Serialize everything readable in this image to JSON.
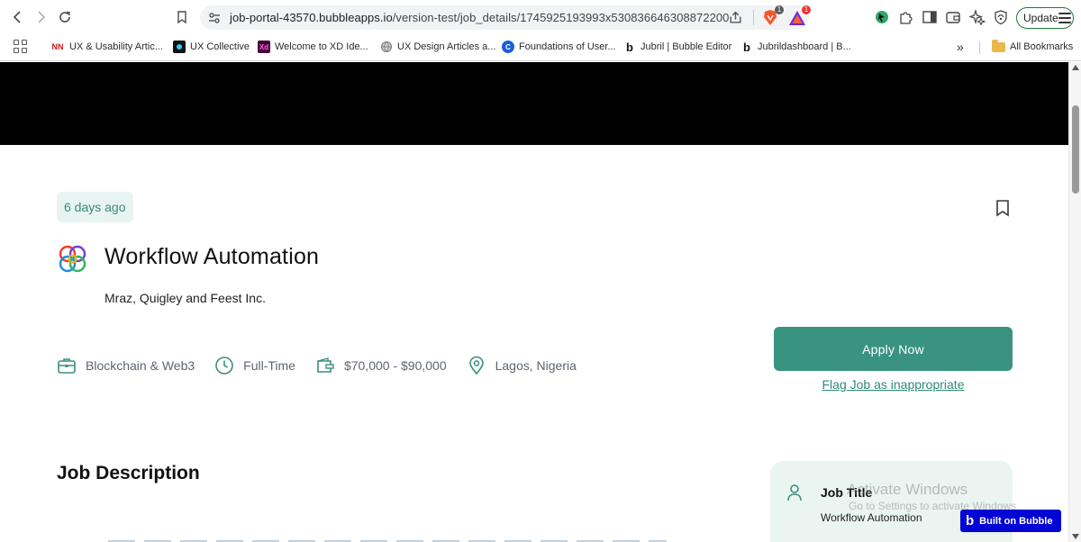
{
  "browser": {
    "url_host": "job-portal-43570.bubbleapps.io",
    "url_path": "/version-test/job_details/1745925193993x530836646308872200",
    "brave_badge": "1",
    "rewards_badge": "1",
    "update_label": "Update",
    "bookmarks": [
      {
        "label": "UX & Usability Artic...",
        "favicon": "NN"
      },
      {
        "label": "UX Collective",
        "favicon": "ux-collective-icon"
      },
      {
        "label": "Welcome to XD Ide...",
        "favicon": "Xd"
      },
      {
        "label": "UX Design Articles a...",
        "favicon": "globe-icon"
      },
      {
        "label": "Foundations of User...",
        "favicon": "C"
      },
      {
        "label": "Jubril | Bubble Editor",
        "favicon": "b"
      },
      {
        "label": "Jubrildashboard | B...",
        "favicon": "b"
      }
    ],
    "more_bookmarks": "»",
    "all_bookmarks_label": "All Bookmarks"
  },
  "job": {
    "posted": "6 days ago",
    "title": "Workflow Automation",
    "company": "Mraz, Quigley and Feest Inc.",
    "category": "Blockchain & Web3",
    "type": "Full-Time",
    "salary": "$70,000 - $90,000",
    "location": "Lagos, Nigeria"
  },
  "actions": {
    "apply_label": "Apply Now",
    "flag_label": "Flag Job as inappropriate"
  },
  "description": {
    "title": "Job Description"
  },
  "summary_card": {
    "label": "Job Title",
    "value": "Workflow Automation"
  },
  "overlay": {
    "watermark_title": "Activate Windows",
    "watermark_sub": "Go to Settings to activate Windows.",
    "bubble_badge": "Built on Bubble"
  },
  "colors": {
    "accent": "#3a9381",
    "chip_bg": "#e8f4f1",
    "card_bg": "#eaf4f1",
    "banner": "#000000",
    "bubble_badge": "#0205d3"
  }
}
